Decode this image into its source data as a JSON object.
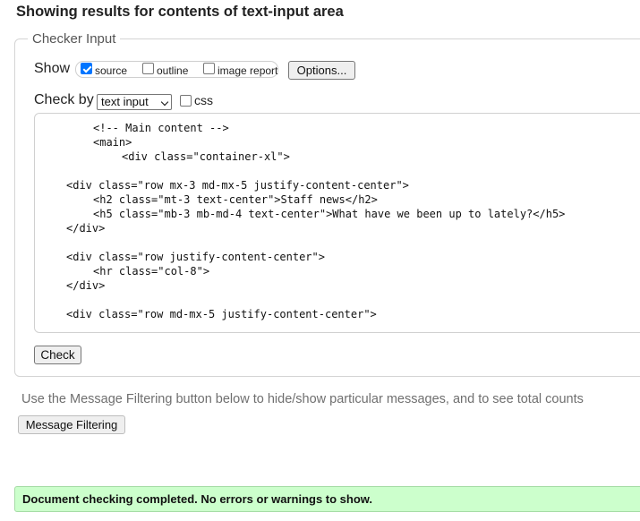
{
  "heading": "Showing results for contents of text-input area",
  "checker": {
    "legend": "Checker Input",
    "show_label": "Show",
    "options": [
      {
        "label": "source",
        "checked": true
      },
      {
        "label": "outline",
        "checked": false
      },
      {
        "label": "image report",
        "checked": false
      }
    ],
    "options_button": "Options...",
    "check_by_label": "Check by",
    "check_by_value": "text input",
    "css_label": "css",
    "css_checked": false,
    "code_lines": [
      "<!-- Main content -->",
      "<main>",
      "<div class=\"container-xl\">",
      "<div class=\"row mx-3 md-mx-5 justify-content-center\">",
      "<h2 class=\"mt-3 text-center\">Staff news</h2>",
      "<h5 class=\"mb-3 mb-md-4 text-center\">What have we been up to lately?</h5>",
      "</div>",
      "<div class=\"row justify-content-center\">",
      "<hr class=\"col-8\">",
      "</div>",
      "<div class=\"row md-mx-5 justify-content-center\">"
    ],
    "check_button": "Check"
  },
  "filter": {
    "note": "Use the Message Filtering button below to hide/show particular messages, and to see total counts",
    "button": "Message Filtering"
  },
  "status": {
    "text": "Document checking completed. No errors or warnings to show.",
    "color": "#ccffcc"
  }
}
